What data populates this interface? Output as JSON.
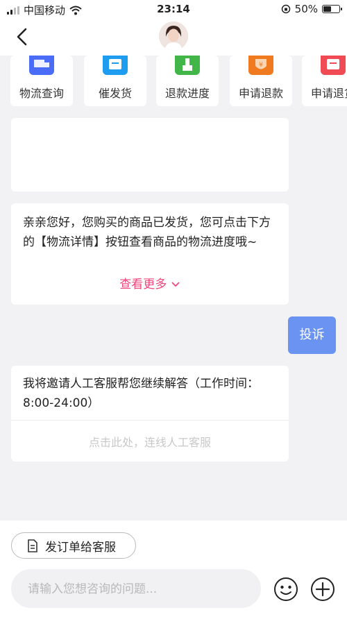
{
  "status_bar": {
    "carrier": "中国移动",
    "time": "23:14",
    "battery": "50%",
    "battery_level": 0.5
  },
  "nav": {
    "back_icon": "chevron-left-icon",
    "avatar_icon": "agent-avatar"
  },
  "quick_actions": [
    {
      "label": "物流查询",
      "icon": "truck-icon",
      "color": "#4a6cf7"
    },
    {
      "label": "催发货",
      "icon": "package-icon",
      "color": "#1e9cf0"
    },
    {
      "label": "退款进度",
      "icon": "progress-icon",
      "color": "#43b649"
    },
    {
      "label": "申请退款",
      "icon": "refund-icon",
      "color": "#f07a1f"
    },
    {
      "label": "申请退货",
      "icon": "return-icon",
      "color": "#f04b54"
    }
  ],
  "messages": {
    "logistics_text": "亲亲您好，您购买的商品已发货，您可点击下方的【物流详情】按钮查看商品的物流进度哦~",
    "see_more": "查看更多",
    "complain": "投诉",
    "transfer_text": "我将邀请人工客服帮您继续解答（工作时间：8:00-24:00）",
    "connect_link": "点击此处，连线人工客服"
  },
  "bottom": {
    "order_button": "发订单给客服",
    "input_placeholder": "请输入您想咨询的问题..."
  },
  "colors": {
    "accent_pink": "#f0457a",
    "complain_blue": "#6b93f2"
  }
}
